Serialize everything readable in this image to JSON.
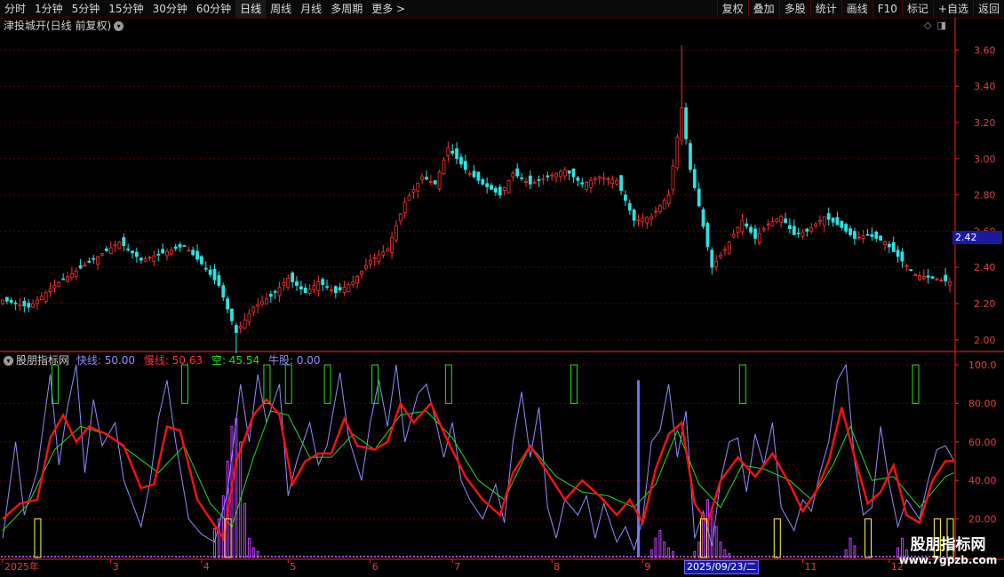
{
  "toolbar": {
    "periods": [
      "分时",
      "1分钟",
      "5分钟",
      "15分钟",
      "30分钟",
      "60分钟",
      "日线",
      "周线",
      "月线",
      "多周期",
      "更多 >"
    ],
    "active_index": 6,
    "buttons": [
      "复权",
      "叠加",
      "多股",
      "统计",
      "画线",
      "F10",
      "标记",
      "+自选",
      "返回"
    ]
  },
  "main_header": {
    "title": "津投城开(日线 前复权)"
  },
  "indicator_header": {
    "name": "股朋指标网",
    "fast_label": "快线: 50.00",
    "slow_label": "慢线: 50.63",
    "short_label": "空: 45.54",
    "bull_label": "牛股: 0.00"
  },
  "current_price": "2.42",
  "selected_date": "2025/09/23/二",
  "watermark": {
    "line1": "股朋指标网",
    "line2": "www.7gpzb.com"
  },
  "colors": {
    "up": "#ff3030",
    "down": "#30e0e0",
    "grid": "#5a0000",
    "axis": "#ff2020",
    "fast": "#9090ff",
    "slow": "#ff1010",
    "short": "#20e020",
    "bull": "#ffff40",
    "purple": "#c040ff"
  },
  "chart_data": [
    {
      "type": "candlestick",
      "title": "津投城开(日线 前复权)",
      "y_ticks": [
        "3.60",
        "3.40",
        "3.20",
        "3.00",
        "2.80",
        "2.60",
        "2.40",
        "2.20",
        "2.00"
      ],
      "ylim": [
        1.94,
        3.7
      ],
      "close_path": [
        [
          0,
          2.22
        ],
        [
          6,
          2.18
        ],
        [
          12,
          2.3
        ],
        [
          17,
          2.38
        ],
        [
          22,
          2.46
        ],
        [
          27,
          2.54
        ],
        [
          32,
          2.44
        ],
        [
          37,
          2.48
        ],
        [
          42,
          2.52
        ],
        [
          46,
          2.42
        ],
        [
          50,
          2.3
        ],
        [
          54,
          2.04
        ],
        [
          58,
          2.18
        ],
        [
          62,
          2.24
        ],
        [
          66,
          2.34
        ],
        [
          70,
          2.26
        ],
        [
          73,
          2.32
        ],
        [
          77,
          2.26
        ],
        [
          81,
          2.32
        ],
        [
          85,
          2.44
        ],
        [
          89,
          2.5
        ],
        [
          93,
          2.76
        ],
        [
          97,
          2.9
        ],
        [
          100,
          2.86
        ],
        [
          103,
          3.06
        ],
        [
          107,
          2.94
        ],
        [
          111,
          2.86
        ],
        [
          115,
          2.8
        ],
        [
          118,
          2.92
        ],
        [
          122,
          2.86
        ],
        [
          126,
          2.9
        ],
        [
          130,
          2.94
        ],
        [
          134,
          2.86
        ],
        [
          138,
          2.9
        ],
        [
          142,
          2.88
        ],
        [
          146,
          2.66
        ],
        [
          150,
          2.68
        ],
        [
          154,
          2.8
        ],
        [
          157,
          3.28
        ],
        [
          159,
          2.94
        ],
        [
          161,
          2.74
        ],
        [
          164,
          2.4
        ],
        [
          167,
          2.5
        ],
        [
          171,
          2.66
        ],
        [
          174,
          2.56
        ],
        [
          177,
          2.64
        ],
        [
          180,
          2.68
        ],
        [
          183,
          2.58
        ],
        [
          186,
          2.6
        ],
        [
          190,
          2.68
        ],
        [
          194,
          2.62
        ],
        [
          197,
          2.56
        ],
        [
          200,
          2.58
        ],
        [
          204,
          2.54
        ],
        [
          207,
          2.46
        ],
        [
          211,
          2.36
        ],
        [
          215,
          2.34
        ],
        [
          219,
          2.32
        ]
      ],
      "n_days": 220,
      "x_ticks": [
        {
          "label": "2025年",
          "day": 0
        },
        {
          "label": "3",
          "day": 25
        },
        {
          "label": "4",
          "day": 46
        },
        {
          "label": "5",
          "day": 66
        },
        {
          "label": "6",
          "day": 85
        },
        {
          "label": "7",
          "day": 104
        },
        {
          "label": "8",
          "day": 127
        },
        {
          "label": "9",
          "day": 148
        },
        {
          "label": "11",
          "day": 185
        },
        {
          "label": "12",
          "day": 205
        }
      ]
    },
    {
      "type": "line",
      "title": "股朋指标网",
      "y_ticks": [
        "100.0",
        "80.00",
        "60.00",
        "40.00",
        "20.00"
      ],
      "ylim": [
        0,
        106
      ],
      "series": [
        {
          "name": "快线",
          "color": "#9090ff"
        },
        {
          "name": "慢线",
          "color": "#ff1010"
        },
        {
          "name": "空",
          "color": "#20e020"
        },
        {
          "name": "牛股",
          "color": "#ffff40"
        }
      ],
      "slow_path": [
        [
          0,
          20
        ],
        [
          4,
          28
        ],
        [
          8,
          30
        ],
        [
          11,
          62
        ],
        [
          14,
          74
        ],
        [
          17,
          60
        ],
        [
          20,
          68
        ],
        [
          24,
          64
        ],
        [
          28,
          58
        ],
        [
          32,
          36
        ],
        [
          35,
          38
        ],
        [
          38,
          68
        ],
        [
          41,
          66
        ],
        [
          45,
          30
        ],
        [
          48,
          20
        ],
        [
          51,
          10
        ],
        [
          54,
          50
        ],
        [
          58,
          74
        ],
        [
          61,
          82
        ],
        [
          64,
          74
        ],
        [
          67,
          38
        ],
        [
          70,
          50
        ],
        [
          73,
          54
        ],
        [
          76,
          54
        ],
        [
          79,
          72
        ],
        [
          82,
          58
        ],
        [
          86,
          56
        ],
        [
          89,
          60
        ],
        [
          92,
          80
        ],
        [
          95,
          70
        ],
        [
          99,
          80
        ],
        [
          103,
          60
        ],
        [
          107,
          42
        ],
        [
          111,
          30
        ],
        [
          115,
          22
        ],
        [
          118,
          44
        ],
        [
          122,
          58
        ],
        [
          126,
          44
        ],
        [
          130,
          30
        ],
        [
          134,
          40
        ],
        [
          138,
          32
        ],
        [
          142,
          22
        ],
        [
          145,
          30
        ],
        [
          148,
          18
        ],
        [
          151,
          46
        ],
        [
          154,
          64
        ],
        [
          157,
          70
        ],
        [
          160,
          28
        ],
        [
          163,
          18
        ],
        [
          166,
          40
        ],
        [
          170,
          52
        ],
        [
          174,
          42
        ],
        [
          178,
          54
        ],
        [
          182,
          38
        ],
        [
          185,
          24
        ],
        [
          188,
          34
        ],
        [
          191,
          50
        ],
        [
          194,
          78
        ],
        [
          197,
          52
        ],
        [
          200,
          28
        ],
        [
          203,
          34
        ],
        [
          206,
          48
        ],
        [
          209,
          22
        ],
        [
          212,
          18
        ],
        [
          215,
          40
        ],
        [
          218,
          50
        ],
        [
          220,
          50
        ]
      ],
      "short_path": [
        [
          0,
          14
        ],
        [
          6,
          28
        ],
        [
          12,
          56
        ],
        [
          18,
          68
        ],
        [
          24,
          64
        ],
        [
          30,
          54
        ],
        [
          36,
          44
        ],
        [
          42,
          58
        ],
        [
          48,
          28
        ],
        [
          53,
          16
        ],
        [
          58,
          52
        ],
        [
          62,
          76
        ],
        [
          66,
          74
        ],
        [
          71,
          52
        ],
        [
          76,
          52
        ],
        [
          81,
          64
        ],
        [
          86,
          56
        ],
        [
          92,
          74
        ],
        [
          98,
          76
        ],
        [
          104,
          62
        ],
        [
          110,
          40
        ],
        [
          116,
          30
        ],
        [
          122,
          58
        ],
        [
          128,
          42
        ],
        [
          134,
          34
        ],
        [
          140,
          32
        ],
        [
          146,
          26
        ],
        [
          151,
          38
        ],
        [
          156,
          66
        ],
        [
          161,
          38
        ],
        [
          166,
          26
        ],
        [
          171,
          48
        ],
        [
          176,
          46
        ],
        [
          182,
          40
        ],
        [
          187,
          30
        ],
        [
          192,
          48
        ],
        [
          196,
          68
        ],
        [
          201,
          40
        ],
        [
          206,
          42
        ],
        [
          212,
          26
        ],
        [
          218,
          42
        ],
        [
          220,
          44
        ]
      ],
      "fast_path": [
        [
          0,
          10
        ],
        [
          3,
          60
        ],
        [
          5,
          22
        ],
        [
          8,
          45
        ],
        [
          11,
          95
        ],
        [
          13,
          48
        ],
        [
          15,
          78
        ],
        [
          17,
          100
        ],
        [
          19,
          44
        ],
        [
          21,
          82
        ],
        [
          23,
          58
        ],
        [
          26,
          70
        ],
        [
          28,
          40
        ],
        [
          30,
          28
        ],
        [
          32,
          16
        ],
        [
          34,
          38
        ],
        [
          36,
          72
        ],
        [
          38,
          92
        ],
        [
          40,
          60
        ],
        [
          43,
          20
        ],
        [
          46,
          12
        ],
        [
          49,
          8
        ],
        [
          52,
          34
        ],
        [
          55,
          90
        ],
        [
          57,
          60
        ],
        [
          59,
          95
        ],
        [
          61,
          70
        ],
        [
          64,
          90
        ],
        [
          66,
          32
        ],
        [
          68,
          50
        ],
        [
          71,
          70
        ],
        [
          73,
          48
        ],
        [
          75,
          58
        ],
        [
          78,
          96
        ],
        [
          80,
          62
        ],
        [
          83,
          40
        ],
        [
          85,
          70
        ],
        [
          87,
          92
        ],
        [
          89,
          68
        ],
        [
          91,
          100
        ],
        [
          93,
          60
        ],
        [
          96,
          85
        ],
        [
          98,
          90
        ],
        [
          100,
          72
        ],
        [
          102,
          52
        ],
        [
          104,
          70
        ],
        [
          106,
          40
        ],
        [
          108,
          30
        ],
        [
          111,
          20
        ],
        [
          114,
          38
        ],
        [
          116,
          18
        ],
        [
          118,
          60
        ],
        [
          120,
          86
        ],
        [
          122,
          52
        ],
        [
          124,
          78
        ],
        [
          126,
          26
        ],
        [
          128,
          10
        ],
        [
          130,
          30
        ],
        [
          133,
          22
        ],
        [
          135,
          32
        ],
        [
          137,
          10
        ],
        [
          139,
          28
        ],
        [
          142,
          8
        ],
        [
          144,
          16
        ],
        [
          146,
          4
        ],
        [
          148,
          20
        ],
        [
          150,
          60
        ],
        [
          152,
          66
        ],
        [
          154,
          90
        ],
        [
          156,
          52
        ],
        [
          158,
          76
        ],
        [
          160,
          10
        ],
        [
          162,
          24
        ],
        [
          164,
          6
        ],
        [
          166,
          40
        ],
        [
          168,
          60
        ],
        [
          170,
          62
        ],
        [
          172,
          34
        ],
        [
          174,
          64
        ],
        [
          176,
          48
        ],
        [
          178,
          70
        ],
        [
          180,
          26
        ],
        [
          183,
          14
        ],
        [
          185,
          30
        ],
        [
          187,
          24
        ],
        [
          189,
          44
        ],
        [
          191,
          60
        ],
        [
          193,
          92
        ],
        [
          195,
          100
        ],
        [
          197,
          50
        ],
        [
          199,
          22
        ],
        [
          201,
          26
        ],
        [
          203,
          68
        ],
        [
          205,
          38
        ],
        [
          207,
          16
        ],
        [
          209,
          30
        ],
        [
          212,
          20
        ],
        [
          214,
          40
        ],
        [
          216,
          56
        ],
        [
          218,
          58
        ],
        [
          220,
          50
        ]
      ],
      "purple_bars": [
        [
          49,
          15
        ],
        [
          50,
          20
        ],
        [
          51,
          32
        ],
        [
          52,
          50
        ],
        [
          53,
          68
        ],
        [
          54,
          72
        ],
        [
          55,
          60
        ],
        [
          56,
          28
        ],
        [
          57,
          10
        ],
        [
          58,
          5
        ],
        [
          59,
          3
        ],
        [
          150,
          4
        ],
        [
          151,
          10
        ],
        [
          152,
          14
        ],
        [
          153,
          8
        ],
        [
          154,
          5
        ],
        [
          155,
          3
        ],
        [
          160,
          3
        ],
        [
          161,
          8
        ],
        [
          162,
          20
        ],
        [
          163,
          30
        ],
        [
          164,
          24
        ],
        [
          165,
          16
        ],
        [
          166,
          8
        ],
        [
          167,
          4
        ],
        [
          168,
          2
        ],
        [
          195,
          4
        ],
        [
          196,
          10
        ],
        [
          197,
          6
        ],
        [
          207,
          5
        ],
        [
          208,
          10
        ],
        [
          209,
          4
        ]
      ],
      "blue_spike_day": 147,
      "green_boxes": [
        12,
        42,
        61,
        66,
        75,
        86,
        103,
        132,
        171,
        211
      ],
      "yellow_boxes": [
        8,
        52,
        162,
        179,
        200,
        216,
        231
      ]
    }
  ]
}
